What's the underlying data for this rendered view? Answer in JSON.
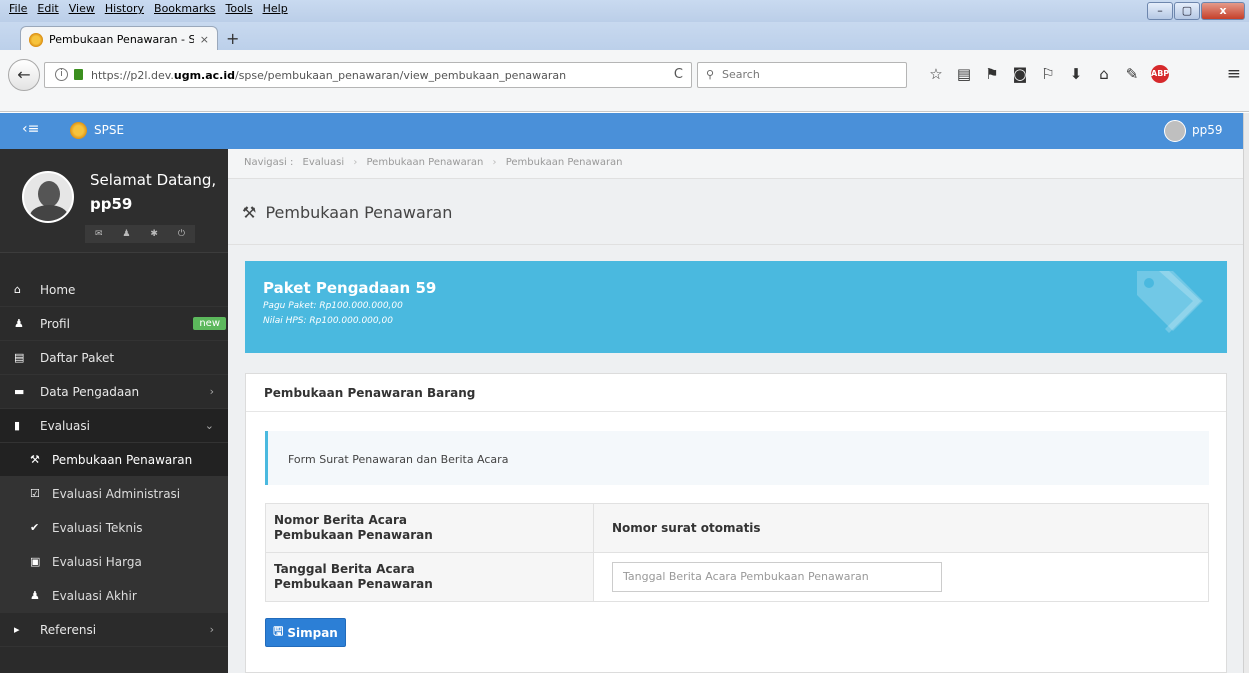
{
  "browser": {
    "menu": [
      "File",
      "Edit",
      "View",
      "History",
      "Bookmarks",
      "Tools",
      "Help"
    ],
    "window_controls": [
      "–",
      "▢",
      "x"
    ],
    "tab": {
      "title": "Pembukaan Penawaran - S...",
      "close": "×"
    },
    "new_tab": "+",
    "back": "←",
    "url_prefix": "https://p2l.dev.",
    "url_domain": "ugm.ac.id",
    "url_path": "/spse/pembukaan_penawaran/view_pembukaan_penawaran",
    "reload": "C",
    "search_placeholder": "Search",
    "abp": "ABP",
    "hamburger": "≡"
  },
  "header": {
    "brand": "SPSE",
    "toggle": "‹≡",
    "username": "pp59"
  },
  "sidebar": {
    "welcome": "Selamat Datang,",
    "username": "pp59",
    "items": [
      {
        "label": "Home",
        "icon": "home-icon",
        "glyph": "⌂"
      },
      {
        "label": "Profil",
        "icon": "user-icon",
        "glyph": "♟",
        "badge": "new"
      },
      {
        "label": "Daftar Paket",
        "icon": "book-icon",
        "glyph": "▤"
      },
      {
        "label": "Data Pengadaan",
        "icon": "briefcase-icon",
        "glyph": "▬",
        "chevron": "›"
      },
      {
        "label": "Evaluasi",
        "icon": "file-icon",
        "glyph": "▮",
        "chevron": "⌄"
      }
    ],
    "sub_items": [
      {
        "label": "Pembukaan Penawaran",
        "icon": "gavel-icon",
        "glyph": "⚒"
      },
      {
        "label": "Evaluasi Administrasi",
        "icon": "checkbox-icon",
        "glyph": "☑"
      },
      {
        "label": "Evaluasi Teknis",
        "icon": "check-icon",
        "glyph": "✔"
      },
      {
        "label": "Evaluasi Harga",
        "icon": "money-icon",
        "glyph": "▣"
      },
      {
        "label": "Evaluasi Akhir",
        "icon": "user-icon",
        "glyph": "♟"
      }
    ],
    "referensi": {
      "label": "Referensi",
      "glyph": "▸",
      "chevron": "›"
    }
  },
  "breadcrumb": {
    "prefix": "Navigasi :",
    "items": [
      "Evaluasi",
      "Pembukaan Penawaran",
      "Pembukaan Penawaran"
    ],
    "sep": "›"
  },
  "page": {
    "title": "Pembukaan Penawaran"
  },
  "banner": {
    "title": "Paket Pengadaan 59",
    "pagu": "Pagu Paket: Rp100.000.000,00",
    "hps": "Nilai HPS: Rp100.000.000,00"
  },
  "panel": {
    "heading": "Pembukaan Penawaran Barang",
    "callout": "Form Surat Penawaran dan Berita Acara",
    "row1_label_1": "Nomor Berita Acara",
    "row1_label_2": "Pembukaan Penawaran",
    "row1_value": "Nomor surat otomatis",
    "row2_label_1": "Tanggal Berita Acara",
    "row2_label_2": "Pembukaan Penawaran",
    "row2_placeholder": "Tanggal Berita Acara Pembukaan Penawaran",
    "save_label": "Simpan"
  },
  "colors": {
    "header_blue": "#4a90d9",
    "banner_cyan": "#4ab9df",
    "sidebar_dark": "#2b2b2b",
    "button_blue": "#2c7fd6",
    "badge_green": "#5cb85c"
  }
}
